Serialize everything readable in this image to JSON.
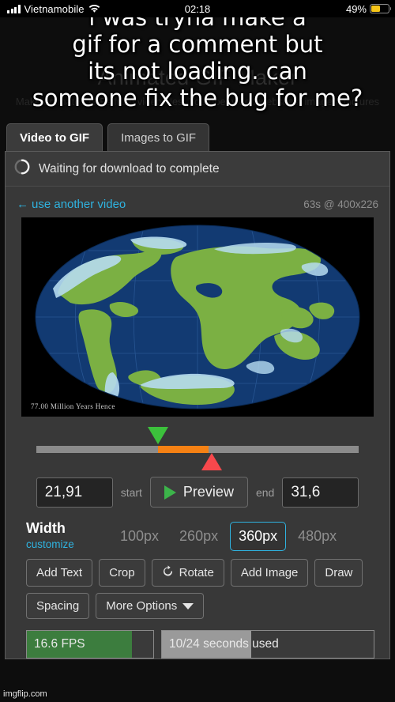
{
  "status_bar": {
    "carrier": "Vietnamobile",
    "time": "02:18",
    "battery_percent": "49%",
    "battery_level": 49,
    "wifi_icon": "wifi-icon",
    "signal_icon": "cellular-signal-icon",
    "battery_icon": "battery-icon",
    "battery_color": "#f5c518"
  },
  "caption": {
    "text": "i was tryna make a gif for a comment but its not loading. can someone fix the bug for me?",
    "line1": "i was tryna make a",
    "line2": "gif for a comment but",
    "line3": "its not loading. can",
    "line4": "someone fix the bug for me?"
  },
  "page_header": {
    "title": "Animated GIF Maker",
    "subtitle": "Make animated GIFs from video files, Youtube, video websites, images, pictures"
  },
  "tabs": [
    {
      "label": "Video to GIF",
      "active": true
    },
    {
      "label": "Images to GIF",
      "active": false
    }
  ],
  "status_row": {
    "spinner_icon": "loading-spinner-icon",
    "text": "Waiting for download to complete"
  },
  "editor": {
    "use_another_video": "use another video",
    "back_arrow": "←",
    "video_meta": "63s @ 400x226",
    "video_caption": "77.00 Million Years Hence",
    "video_duration_seconds": 63,
    "video_resolution": "400x226"
  },
  "trim": {
    "start_handle_icon": "trim-start-handle",
    "end_handle_icon": "trim-end-handle",
    "start_percent": 34.8,
    "end_percent": 50.2,
    "track_color": "#8b8b8b",
    "range_color": "#f58114",
    "start_color": "#3cc13c",
    "end_color": "#f8484c"
  },
  "time_controls": {
    "start_value": "21,91",
    "start_label": "start",
    "preview_label": "Preview",
    "play_icon": "play-icon",
    "end_label": "end",
    "end_value": "31,6"
  },
  "width": {
    "label": "Width",
    "customize": "customize",
    "options": [
      {
        "label": "100px",
        "selected": false
      },
      {
        "label": "260px",
        "selected": false
      },
      {
        "label": "360px",
        "selected": true
      },
      {
        "label": "480px",
        "selected": false
      }
    ],
    "selected": "360px",
    "accent_color": "#2fb3e0"
  },
  "tools": {
    "row1": [
      {
        "label": "Add Text",
        "icon": null
      },
      {
        "label": "Crop",
        "icon": null
      },
      {
        "label": "Rotate",
        "icon": "rotate-icon"
      },
      {
        "label": "Add Image",
        "icon": null
      },
      {
        "label": "Draw",
        "icon": null
      }
    ],
    "row2": [
      {
        "label": "Spacing",
        "icon": null
      },
      {
        "label": "More Options",
        "icon": "chevron-down-icon"
      }
    ]
  },
  "meters": {
    "fps": {
      "text": "16.6 FPS",
      "fill_percent": 83,
      "color": "#3c7d3e"
    },
    "seconds": {
      "text": "10/24 seconds used",
      "fill_percent": 42,
      "color": "#9a9a9a"
    }
  },
  "watermark": "imgflip.com"
}
